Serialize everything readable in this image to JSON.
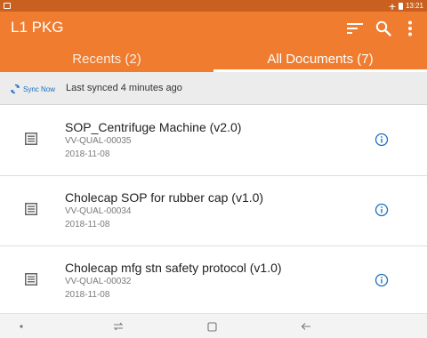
{
  "status_bar": {
    "time": "13:21"
  },
  "app_bar": {
    "title": "L1 PKG"
  },
  "tabs": [
    {
      "label": "Recents (2)",
      "active": false
    },
    {
      "label": "All Documents (7)",
      "active": true
    }
  ],
  "sync": {
    "button_label": "Sync Now",
    "status": "Last synced 4 minutes ago"
  },
  "documents": [
    {
      "title": "SOP_Centrifuge Machine (v2.0)",
      "id": "VV-QUAL-00035",
      "date": "2018-11-08"
    },
    {
      "title": "Cholecap SOP for rubber cap (v1.0)",
      "id": "VV-QUAL-00034",
      "date": "2018-11-08"
    },
    {
      "title": "Cholecap mfg stn safety protocol (v1.0)",
      "id": "VV-QUAL-00032",
      "date": "2018-11-08"
    }
  ],
  "colors": {
    "primary": "#ef7c2f",
    "status_bar": "#c9601f",
    "accent_blue": "#1b6fc2"
  },
  "icons": [
    "image-icon",
    "airplane-icon",
    "battery-icon",
    "sort-icon",
    "search-icon",
    "overflow-menu-icon",
    "sync-icon",
    "document-icon",
    "info-icon",
    "recent-apps-icon",
    "home-icon",
    "back-icon"
  ]
}
